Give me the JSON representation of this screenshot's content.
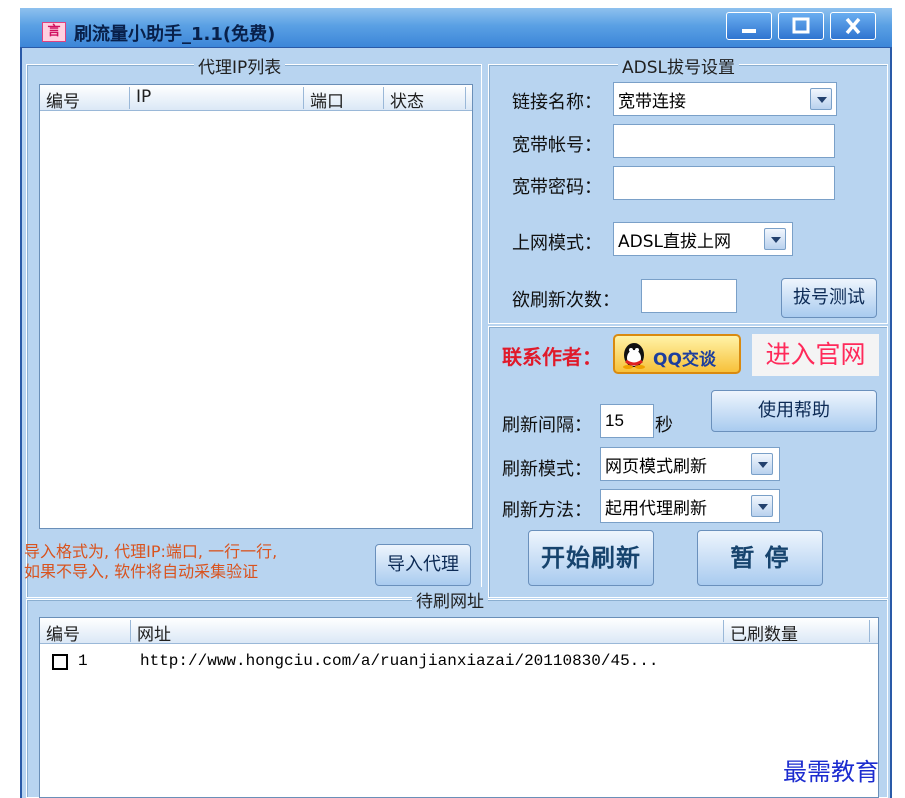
{
  "window": {
    "icon_char": "言",
    "title": "刷流量小助手_1.1(免费)",
    "btn_min": "_",
    "btn_max": "□",
    "btn_close": "X"
  },
  "proxy": {
    "legend": "代理IP列表",
    "columns": [
      "编号",
      "IP",
      "端口",
      "状态"
    ],
    "hint_line1": "导入格式为, 代理IP:端口, 一行一行,",
    "hint_line2": "如果不导入, 软件将自动采集验证",
    "import_label": "导入代理"
  },
  "adsl": {
    "legend": "ADSL拔号设置",
    "conn_label": "链接名称：",
    "conn_value": "宽带连接",
    "account_label": "宽带帐号：",
    "account_value": "",
    "password_label": "宽带密码：",
    "password_value": "",
    "mode_label": "上网模式：",
    "mode_value": "ADSL直拔上网",
    "count_label": "欲刷新次数：",
    "count_value": "",
    "dial_test_label": "拔号测试"
  },
  "contact": {
    "label": "联系作者：",
    "qq_label": "QQ交谈",
    "site_label": "进入官网"
  },
  "refresh": {
    "interval_label": "刷新间隔：",
    "interval_value": "15",
    "interval_unit": "秒",
    "help_label": "使用帮助",
    "mode_label": "刷新模式：",
    "mode_value": "网页模式刷新",
    "method_label": "刷新方法：",
    "method_value": "起用代理刷新",
    "start_label": "开始刷新",
    "pause_label": "暂 停"
  },
  "urls": {
    "legend": "待刷网址",
    "columns": [
      "编号",
      "网址",
      "已刷数量"
    ],
    "rows": [
      {
        "id": "1",
        "url": "http://www.hongciu.com/a/ruanjianxiazai/20110830/45...",
        "count": ""
      }
    ]
  },
  "watermark": "最需教育"
}
